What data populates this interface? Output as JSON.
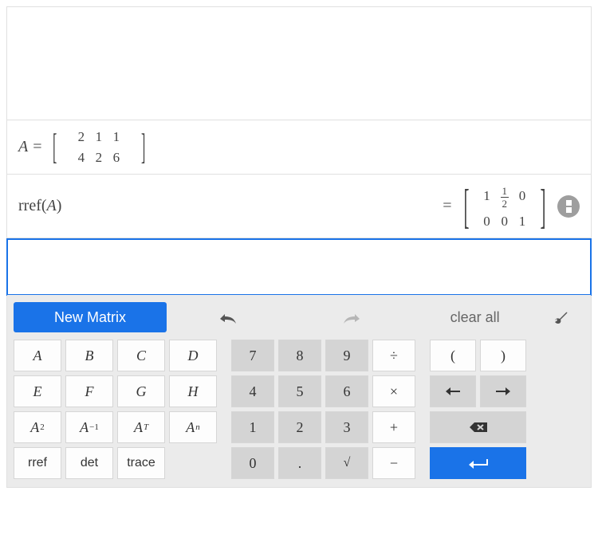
{
  "definition": {
    "name": "A",
    "rows": [
      [
        "2",
        "1",
        "1"
      ],
      [
        "4",
        "2",
        "6"
      ]
    ]
  },
  "expression": {
    "func": "rref",
    "arg": "A"
  },
  "result": {
    "rows": [
      [
        "1",
        "1/2",
        "0"
      ],
      [
        "0",
        "0",
        "1"
      ]
    ]
  },
  "toolbar": {
    "newMatrix": "New Matrix",
    "clearAll": "clear all"
  },
  "matrixKeys": {
    "r1": [
      "A",
      "B",
      "C",
      "D"
    ],
    "r2": [
      "E",
      "F",
      "G",
      "H"
    ],
    "ops": {
      "sq": "2",
      "inv": "-1",
      "tr": "T",
      "pow": "n"
    },
    "funcs": [
      "rref",
      "det",
      "trace"
    ]
  },
  "numpad": {
    "d7": "7",
    "d8": "8",
    "d9": "9",
    "d4": "4",
    "d5": "5",
    "d6": "6",
    "d1": "1",
    "d2": "2",
    "d3": "3",
    "d0": "0",
    "dot": ".",
    "div": "÷",
    "mul": "×",
    "add": "+",
    "sub": "−",
    "sqrt": "√"
  },
  "paren": {
    "open": "(",
    "close": ")"
  }
}
